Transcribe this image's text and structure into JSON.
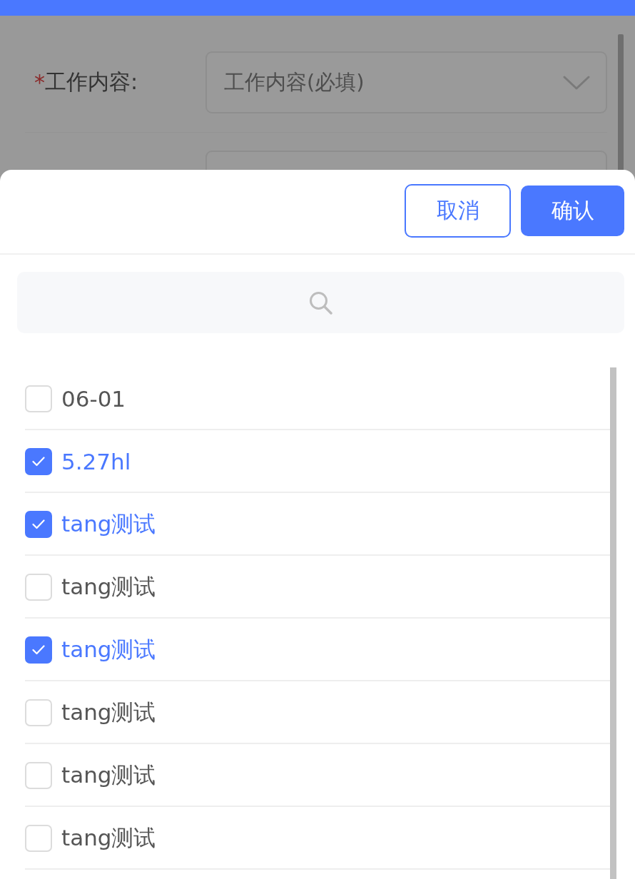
{
  "form": {
    "fields": [
      {
        "kind": "select",
        "required_mark": "*",
        "label": "工作内容:",
        "placeholder": "工作内容(必填)"
      },
      {
        "kind": "input"
      }
    ]
  },
  "sheet": {
    "buttons": [
      {
        "kind": "outline",
        "label": "取消"
      },
      {
        "kind": "primary",
        "label": "确认"
      }
    ],
    "options": [
      {
        "label": "06-01",
        "checked": false
      },
      {
        "label": "5.27hl",
        "checked": true
      },
      {
        "label": "tang测试",
        "checked": true
      },
      {
        "label": "tang测试",
        "checked": false
      },
      {
        "label": "tang测试",
        "checked": true
      },
      {
        "label": "tang测试",
        "checked": false
      },
      {
        "label": "tang测试",
        "checked": false
      },
      {
        "label": "tang测试",
        "checked": false
      }
    ]
  }
}
